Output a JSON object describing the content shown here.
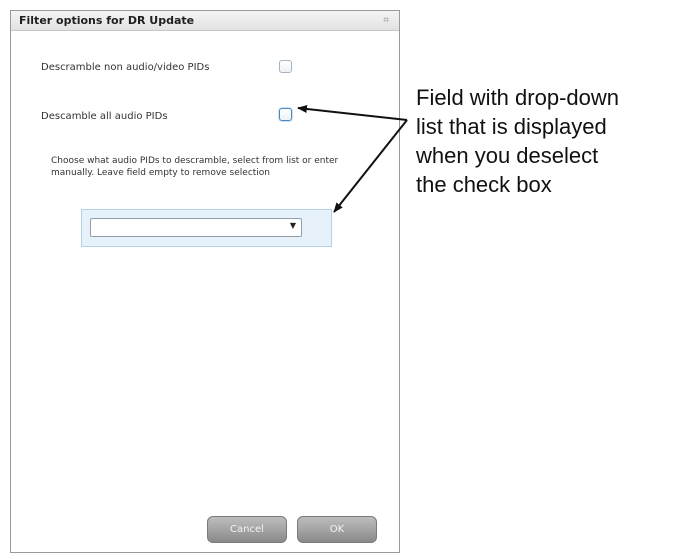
{
  "dialog": {
    "title": "Filter options for DR Update",
    "title_control": "⌗",
    "option1_label": "Descramble non audio/video PIDs",
    "option2_label": "Descamble all audio PIDs",
    "help_text": "Choose what audio PIDs to descramble, select from list or enter manually. Leave field empty to remove selection",
    "combo_value": "",
    "combo_arrow": "▼",
    "cancel_label": "Cancel",
    "ok_label": "OK"
  },
  "annotation": {
    "lines": [
      "Field with drop-down",
      "list that is displayed",
      "when you deselect",
      "the check box"
    ]
  },
  "colors": {
    "panel_bg": "#e6f1fa",
    "button_gradient_top": "#bdbdbd",
    "button_gradient_bottom": "#8a8a8a",
    "focus_border": "#4f88b8"
  }
}
